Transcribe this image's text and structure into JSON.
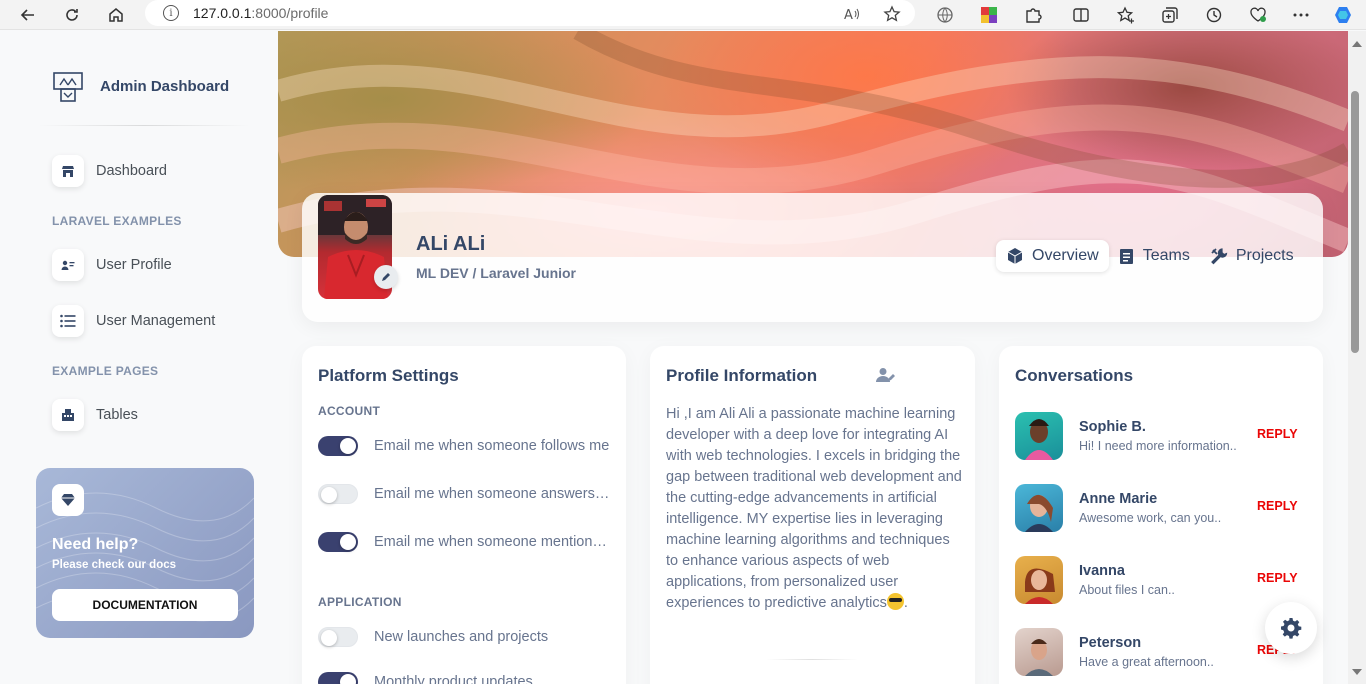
{
  "browser": {
    "url_host": "127.0.0.1",
    "url_path": ":8000/profile"
  },
  "sidebar": {
    "brand": "Admin Dashboard",
    "items": [
      {
        "label": "Dashboard",
        "icon": "shop-icon"
      },
      {
        "label": "User Profile",
        "icon": "user-card-icon"
      },
      {
        "label": "User Management",
        "icon": "list-icon"
      },
      {
        "label": "Tables",
        "icon": "office-icon"
      }
    ],
    "sections": [
      "LARAVEL EXAMPLES",
      "EXAMPLE PAGES"
    ],
    "help": {
      "title": "Need help?",
      "subtitle": "Please check our docs",
      "button": "DOCUMENTATION"
    }
  },
  "profile": {
    "name": "ALi ALi",
    "role": "ML DEV / Laravel Junior",
    "tabs": [
      {
        "label": "Overview",
        "active": true
      },
      {
        "label": "Teams",
        "active": false
      },
      {
        "label": "Projects",
        "active": false
      }
    ]
  },
  "platform_settings": {
    "title": "Platform Settings",
    "account_label": "ACCOUNT",
    "account": [
      {
        "label": "Email me when someone follows me",
        "on": true
      },
      {
        "label": "Email me when someone answers on my post",
        "on": false
      },
      {
        "label": "Email me when someone mentions me",
        "on": true
      }
    ],
    "application_label": "APPLICATION",
    "application": [
      {
        "label": "New launches and projects",
        "on": false
      },
      {
        "label": "Monthly product updates",
        "on": true
      }
    ]
  },
  "profile_information": {
    "title": "Profile Information",
    "text": "Hi ,I am Ali Ali a passionate machine learning developer with a deep love for integrating AI with web technologies. I excels in bridging the gap between traditional web development and the cutting-edge advancements in artificial intelligence. MY expertise lies in leveraging machine learning algorithms and techniques to enhance various aspects of web applications, from personalized user experiences to predictive analytics",
    "text_end": "."
  },
  "conversations": {
    "title": "Conversations",
    "reply_label": "REPLY",
    "items": [
      {
        "name": "Sophie B.",
        "message": "Hi! I need more information..",
        "color": "#2ab3a6"
      },
      {
        "name": "Anne Marie",
        "message": "Awesome work, can you..",
        "color": "#3fa7c9"
      },
      {
        "name": "Ivanna",
        "message": "About files I can..",
        "color": "#d9a04a"
      },
      {
        "name": "Peterson",
        "message": "Have a great afternoon..",
        "color": "#c9b2aa"
      }
    ]
  },
  "colors": {
    "accent": "#344767",
    "toggle_on": "#3a416f",
    "reply": "#ea0606"
  }
}
